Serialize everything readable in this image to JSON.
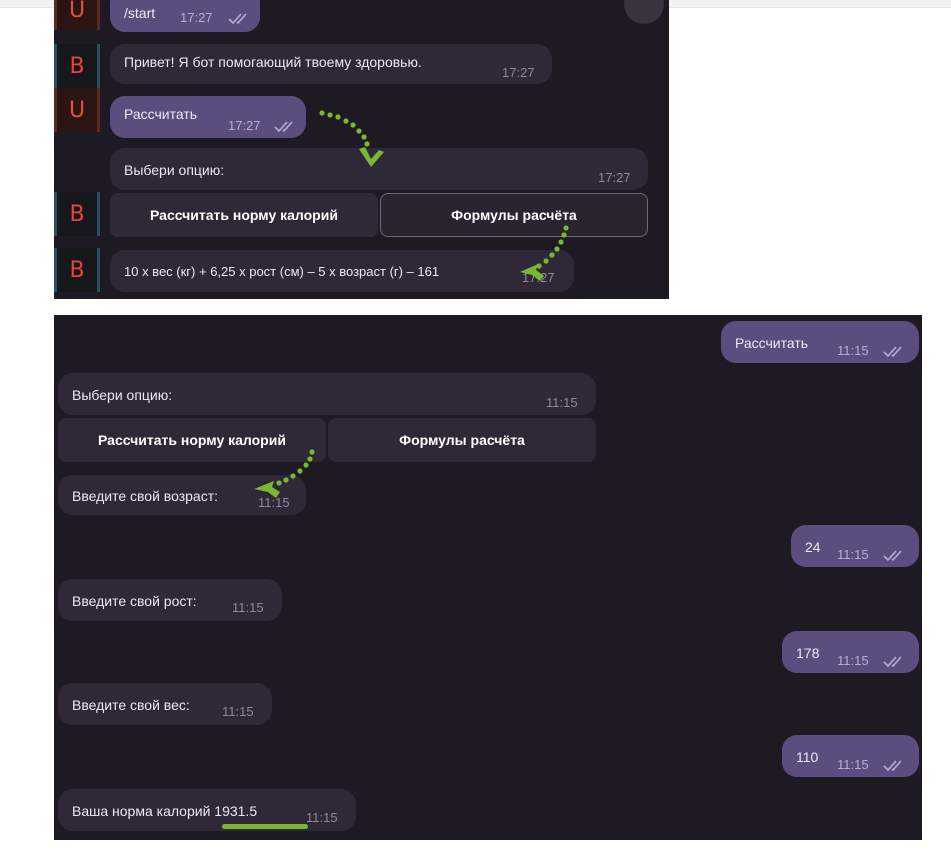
{
  "colors": {
    "panel_bg": "#1e1a24",
    "incoming_bubble": "#2f2937",
    "outgoing_bubble": "#5b4d7e",
    "annotation_green": "#7ab833",
    "avatar_letter": "#e9433b"
  },
  "top_chat": {
    "avatars": {
      "bot": "B",
      "user": "U"
    },
    "messages": {
      "start": {
        "text": "/start",
        "time": "17:27"
      },
      "greeting": {
        "text": "Привет! Я бот помогающий твоему здоровью.",
        "time": "17:27"
      },
      "calc_request": {
        "text": "Рассчитать",
        "time": "17:27"
      },
      "choose_option": {
        "text": "Выбери опцию:",
        "time": "17:27"
      },
      "formula": {
        "text": "10 х вес (кг) + 6,25 x рост (см) – 5 х возраст (г) – 161",
        "time": "17:27"
      }
    },
    "keyboard": {
      "calories_button": "Рассчитать норму калорий",
      "formulas_button": "Формулы расчёта"
    }
  },
  "bottom_chat": {
    "messages": {
      "calc_request": {
        "text": "Рассчитать",
        "time": "11:15"
      },
      "choose_option": {
        "text": "Выбери опцию:",
        "time": "11:15"
      },
      "ask_age": {
        "text": "Введите свой возраст:",
        "time": "11:15"
      },
      "age_answer": {
        "text": "24",
        "time": "11:15"
      },
      "ask_height": {
        "text": "Введите свой рост:",
        "time": "11:15"
      },
      "height_answer": {
        "text": "178",
        "time": "11:15"
      },
      "ask_weight": {
        "text": "Введите свой вес:",
        "time": "11:15"
      },
      "weight_answer": {
        "text": "110",
        "time": "11:15"
      },
      "result": {
        "text": "Ваша норма калорий 1931.5",
        "time": "11:15"
      }
    },
    "keyboard": {
      "calories_button": "Рассчитать норму калорий",
      "formulas_button": "Формулы расчёта"
    }
  }
}
